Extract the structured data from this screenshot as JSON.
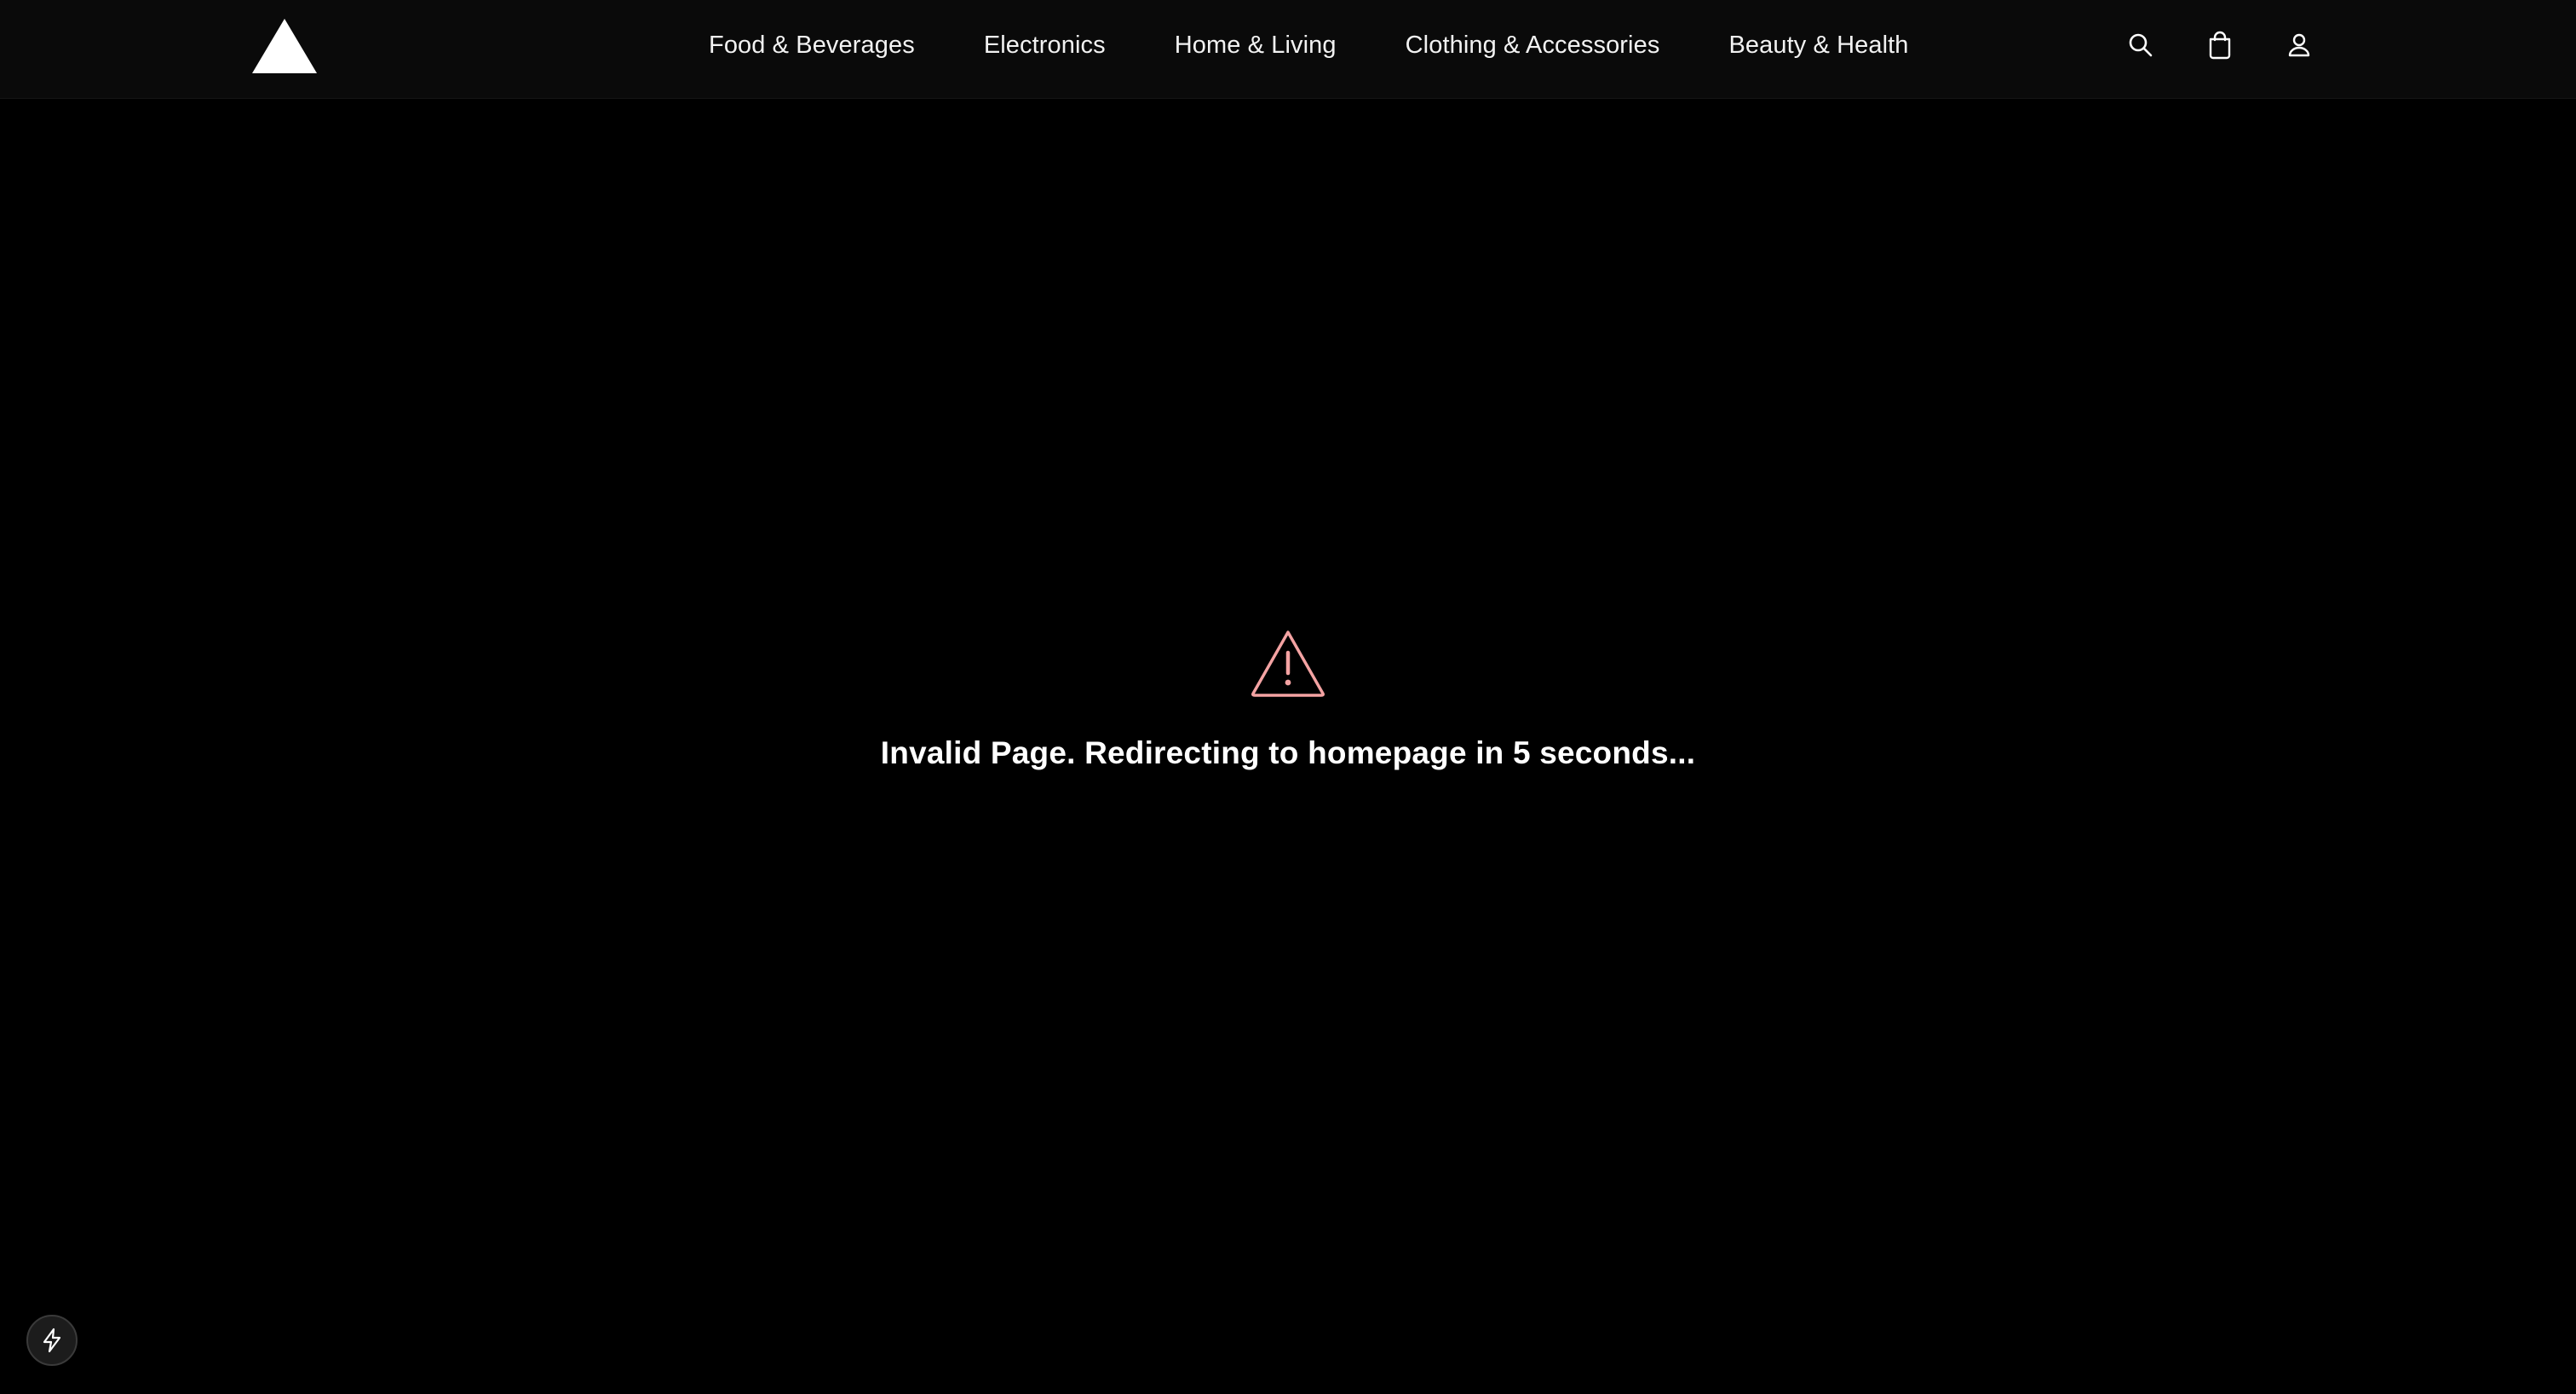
{
  "header": {
    "logo_icon": "triangle-logo-icon",
    "nav": [
      {
        "label": "Food & Beverages"
      },
      {
        "label": "Electronics"
      },
      {
        "label": "Home & Living"
      },
      {
        "label": "Clothing & Accessories"
      },
      {
        "label": "Beauty & Health"
      }
    ],
    "actions": [
      {
        "icon": "search-icon"
      },
      {
        "icon": "shopping-bag-icon"
      },
      {
        "icon": "user-icon"
      }
    ]
  },
  "main": {
    "notice_icon": "warning-triangle-icon",
    "notice_text": "Invalid Page. Redirecting to homepage in 5 seconds..."
  },
  "dev_badge": {
    "icon": "lightning-bolt-icon"
  },
  "colors": {
    "background": "#000000",
    "header_background": "#0a0a0a",
    "warning": "#f4a3a3",
    "text": "#ffffff"
  }
}
